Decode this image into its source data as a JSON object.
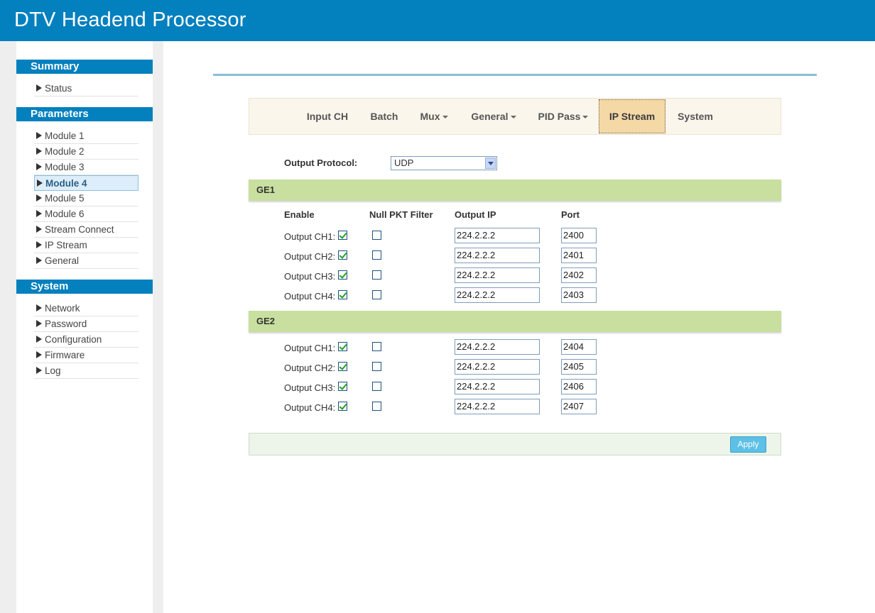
{
  "header": {
    "title": "DTV Headend Processor"
  },
  "sidebar": {
    "summary": {
      "heading": "Summary",
      "items": [
        {
          "label": "Status"
        }
      ]
    },
    "parameters": {
      "heading": "Parameters",
      "items": [
        {
          "label": "Module 1"
        },
        {
          "label": "Module 2"
        },
        {
          "label": "Module 3"
        },
        {
          "label": "Module 4"
        },
        {
          "label": "Module 5"
        },
        {
          "label": "Module 6"
        },
        {
          "label": "Stream Connect"
        },
        {
          "label": "IP Stream"
        },
        {
          "label": "General"
        }
      ],
      "active": "Module 4"
    },
    "system": {
      "heading": "System",
      "items": [
        {
          "label": "Network"
        },
        {
          "label": "Password"
        },
        {
          "label": "Configuration"
        },
        {
          "label": "Firmware"
        },
        {
          "label": "Log"
        }
      ]
    }
  },
  "tabs": [
    {
      "label": "Input CH"
    },
    {
      "label": "Batch"
    },
    {
      "label": "Mux"
    },
    {
      "label": "General"
    },
    {
      "label": "PID Pass"
    },
    {
      "label": "IP Stream"
    },
    {
      "label": "System"
    }
  ],
  "active_tab": "IP Stream",
  "protocol": {
    "label": "Output Protocol:",
    "value": "UDP"
  },
  "columns": {
    "enable": "Enable",
    "null_filter": "Null PKT Filter",
    "output_ip": "Output IP",
    "port": "Port"
  },
  "ge1": {
    "label": "GE1",
    "rows": [
      {
        "label": "Output CH1:",
        "enabled": true,
        "null_filter": false,
        "ip": "224.2.2.2",
        "port": "2400"
      },
      {
        "label": "Output CH2:",
        "enabled": true,
        "null_filter": false,
        "ip": "224.2.2.2",
        "port": "2401"
      },
      {
        "label": "Output CH3:",
        "enabled": true,
        "null_filter": false,
        "ip": "224.2.2.2",
        "port": "2402"
      },
      {
        "label": "Output CH4:",
        "enabled": true,
        "null_filter": false,
        "ip": "224.2.2.2",
        "port": "2403"
      }
    ]
  },
  "ge2": {
    "label": "GE2",
    "rows": [
      {
        "label": "Output CH1:",
        "enabled": true,
        "null_filter": false,
        "ip": "224.2.2.2",
        "port": "2404"
      },
      {
        "label": "Output CH2:",
        "enabled": true,
        "null_filter": false,
        "ip": "224.2.2.2",
        "port": "2405"
      },
      {
        "label": "Output CH3:",
        "enabled": true,
        "null_filter": false,
        "ip": "224.2.2.2",
        "port": "2406"
      },
      {
        "label": "Output CH4:",
        "enabled": true,
        "null_filter": false,
        "ip": "224.2.2.2",
        "port": "2407"
      }
    ]
  },
  "apply": {
    "label": "Apply"
  },
  "colors": {
    "brand_blue": "#0380be",
    "group_green": "#c8df9f",
    "tab_active": "#f4d9a6",
    "apply_blue": "#5dc0e6"
  }
}
